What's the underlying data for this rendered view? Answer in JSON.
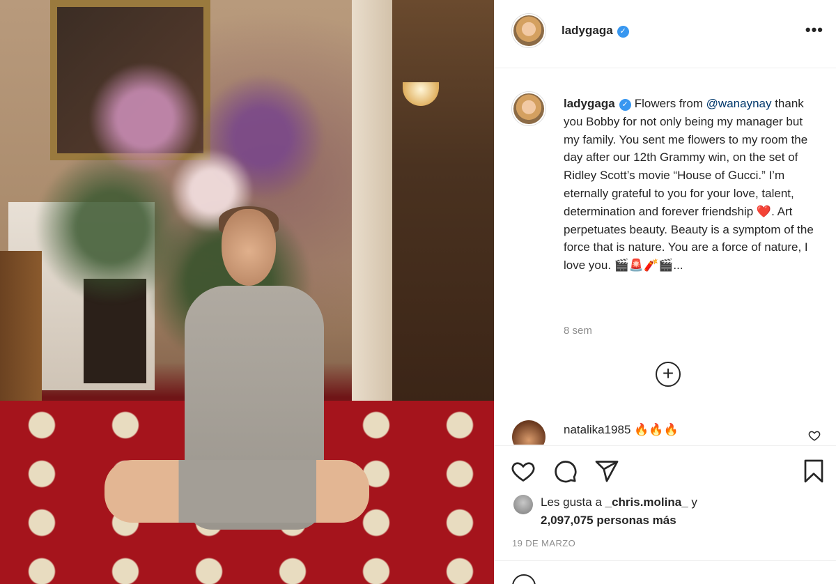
{
  "post": {
    "username": "ladygaga",
    "verified_mark": "✓",
    "more_label": "•••"
  },
  "caption": {
    "username": "ladygaga",
    "verified_mark": "✓",
    "text_before_mention": "Flowers from ",
    "mention": "@wanaynay",
    "text_after_mention": " thank you Bobby for not only being my manager but my family. You sent me flowers to my room the day after our 12th Grammy win, on the set of Ridley Scott’s movie “House of Gucci.” I’m eternally grateful to you for your love, talent, determination and forever friendship ",
    "heart_emoji": "❤️",
    "text_end": ". Art perpetuates beauty. Beauty is a symptom of the force that is nature. You are a force of nature, I love you. 🎬🚨🧨🎬...",
    "age": "8 sem",
    "load_more": "+"
  },
  "comment": {
    "username": "natalika1985",
    "text": "🔥🔥🔥"
  },
  "likes": {
    "prefix": "Les gusta a ",
    "liker": "_chris.molina_",
    "middle": " y ",
    "count": "2,097,075 personas más"
  },
  "date": "19 DE MARZO",
  "colors": {
    "verified": "#3897f0",
    "mention": "#00376b",
    "secondary_text": "#8e8e8e",
    "divider": "#efefef"
  },
  "icons": [
    "heart-icon",
    "comment-icon",
    "share-icon",
    "bookmark-icon",
    "more-icon",
    "add-circle-icon"
  ]
}
